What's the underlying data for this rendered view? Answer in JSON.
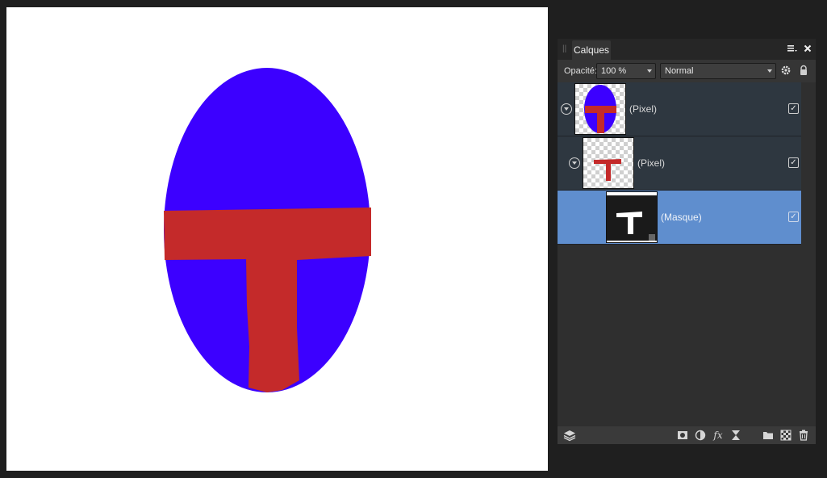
{
  "panel": {
    "tab_title": "Calques",
    "opacity_label": "Opacité:",
    "opacity_value": "100 %",
    "blend_mode": "Normal",
    "fx_label": "fx"
  },
  "layers": [
    {
      "label": "(Pixel)",
      "visible": true,
      "thumbnail": "blue-ellipse-with-red-t"
    },
    {
      "label": "(Pixel)",
      "visible": true,
      "thumbnail": "red-t"
    },
    {
      "label": "(Masque)",
      "visible": true,
      "thumbnail": "white-t-on-black",
      "selected": true
    }
  ],
  "colors": {
    "ellipse_fill": "#3c00ff",
    "stroke_red": "#c42a2a",
    "selection": "#5f8ece"
  }
}
